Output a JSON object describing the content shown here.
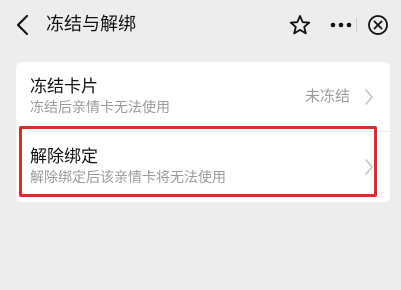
{
  "header": {
    "title": "冻结与解绑"
  },
  "items": [
    {
      "title": "冻结卡片",
      "subtitle": "冻结后亲情卡无法使用",
      "status": "未冻结"
    },
    {
      "title": "解除绑定",
      "subtitle": "解除绑定后该亲情卡将无法使用"
    }
  ],
  "colors": {
    "background": "#ededed",
    "highlight": "#d32f2f",
    "secondary_text": "#9b9b9b"
  },
  "icons": [
    "back-arrow-icon",
    "star-icon",
    "more-icon",
    "close-icon",
    "chevron-right-icon"
  ]
}
